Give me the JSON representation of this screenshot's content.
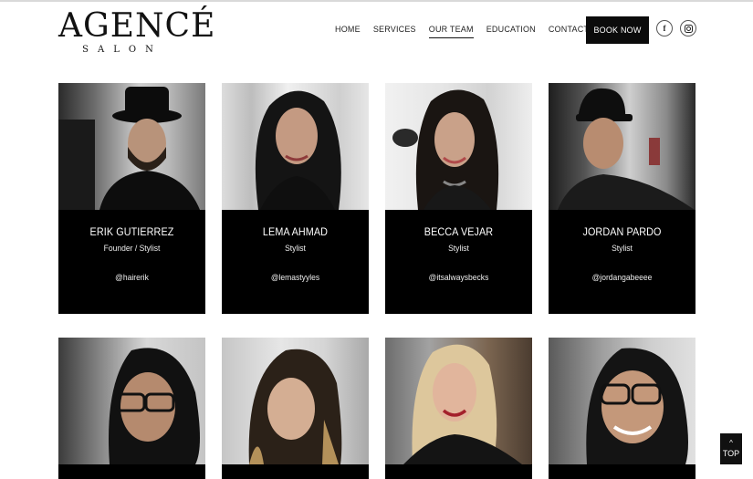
{
  "brand": {
    "name": "AGENCÉ",
    "sub": "SALON"
  },
  "nav": [
    {
      "label": "HOME"
    },
    {
      "label": "SERVICES"
    },
    {
      "label": "OUR TEAM",
      "active": true
    },
    {
      "label": "EDUCATION"
    },
    {
      "label": "CONTACT US"
    }
  ],
  "book_label": "BOOK NOW",
  "social": {
    "facebook": "f"
  },
  "team": [
    {
      "name": "ERIK GUTIERREZ",
      "role": "Founder / Stylist",
      "handle": "@hairerik"
    },
    {
      "name": "LEMA AHMAD",
      "role": "Stylist",
      "handle": "@lemastyyles"
    },
    {
      "name": "BECCA VEJAR",
      "role": "Stylist",
      "handle": "@itsalwaysbecks"
    },
    {
      "name": "JORDAN PARDO",
      "role": "Stylist",
      "handle": "@jordangabeeee"
    }
  ],
  "back_to_top": {
    "arrow": "^",
    "label": "TOP"
  },
  "colors": {
    "card_bg": "#000000",
    "accent": "#0b0b0b",
    "text": "#111111"
  }
}
